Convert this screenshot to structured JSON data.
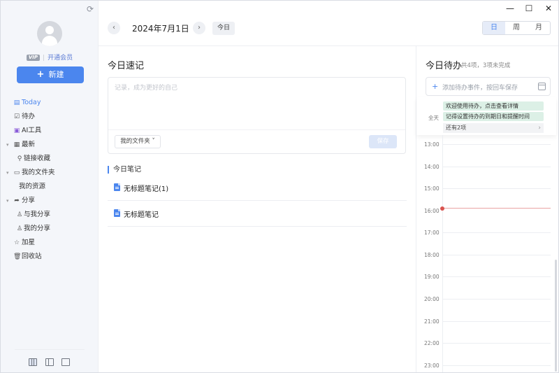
{
  "window": {
    "minimize": "—",
    "maximize": "☐",
    "close": "✕"
  },
  "sidebar": {
    "vip_badge": "VIP",
    "vip_link": "开通会员",
    "new_button": "新建",
    "nav": [
      {
        "label": "Today",
        "icon": "calendar-icon",
        "active": true
      },
      {
        "label": "待办",
        "icon": "checkbox-icon"
      },
      {
        "label": "AI工具",
        "icon": "ai-icon"
      },
      {
        "label": "最新",
        "icon": "grid-icon",
        "expandable": true
      },
      {
        "label": "链接收藏",
        "icon": "link-icon"
      },
      {
        "label": "我的文件夹",
        "icon": "folder-icon",
        "expandable": true
      },
      {
        "label": "我的资源"
      },
      {
        "label": "分享",
        "icon": "share-icon",
        "expandable": true
      },
      {
        "label": "与我分享",
        "icon": "user-icon"
      },
      {
        "label": "我的分享",
        "icon": "user-icon"
      },
      {
        "label": "加星",
        "icon": "star-icon"
      },
      {
        "label": "回收站",
        "icon": "trash-icon"
      }
    ]
  },
  "header": {
    "prev": "‹",
    "next": "›",
    "date": "2024年7月1日",
    "today_button": "今日",
    "views": [
      "日",
      "周",
      "月"
    ],
    "active_view": "日"
  },
  "quicknote": {
    "title": "今日速记",
    "placeholder": "记录，成为更好的自己",
    "folder": "我的文件夹",
    "save": "保存"
  },
  "notes": {
    "title": "今日笔记",
    "items": [
      "无标题笔记(1)",
      "无标题笔记"
    ]
  },
  "todo": {
    "title": "今日待办",
    "summary": "共4项，3项未完成",
    "input_placeholder": "添加待办事件，按回车保存",
    "allday_label": "全天",
    "events": [
      "欢迎使用待办，点击查看详情",
      "记得设置待办的到期日和提醒时间"
    ],
    "more": "还有2项",
    "hours": [
      "13:00",
      "14:00",
      "15:00",
      "16:00",
      "17:00",
      "18:00",
      "19:00",
      "20:00",
      "21:00",
      "22:00",
      "23:00"
    ]
  },
  "colors": {
    "accent": "#4b86ee",
    "event_bg": "#dcf0e6",
    "now_line": "#d9534f"
  }
}
